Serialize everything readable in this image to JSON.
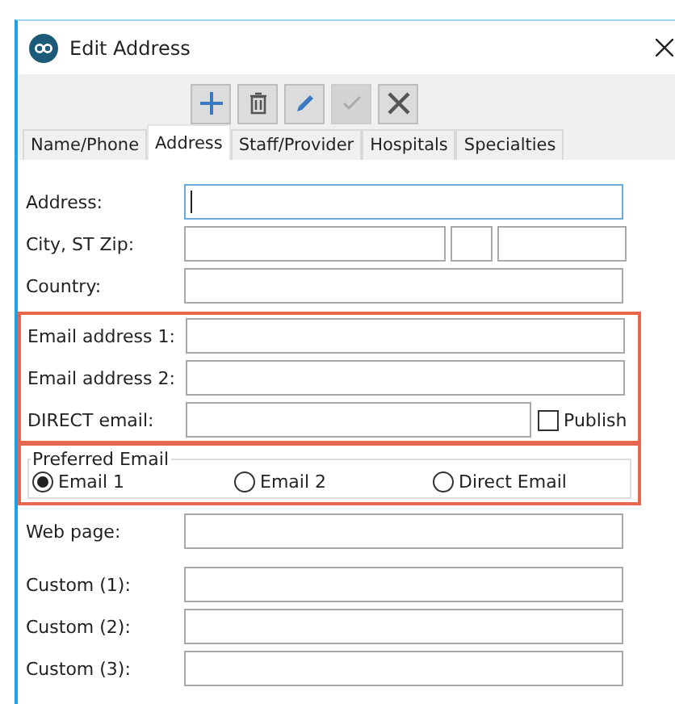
{
  "window": {
    "title": "Edit Address"
  },
  "toolbar": [
    {
      "kind": "add",
      "disabled": false
    },
    {
      "kind": "delete",
      "disabled": false
    },
    {
      "kind": "edit",
      "disabled": false
    },
    {
      "kind": "save",
      "disabled": true
    },
    {
      "kind": "cancel",
      "disabled": false
    }
  ],
  "tabs": [
    {
      "label": "Name/Phone",
      "selected": false
    },
    {
      "label": "Address",
      "selected": true
    },
    {
      "label": "Staff/Provider",
      "selected": false
    },
    {
      "label": "Hospitals",
      "selected": false
    },
    {
      "label": "Specialties",
      "selected": false
    }
  ],
  "sections": [
    {
      "highlighted": false,
      "rows": [
        {
          "kind": "text",
          "label": "Address:",
          "focused": true
        },
        {
          "kind": "city",
          "label": "City, ST Zip:",
          "focused": false
        },
        {
          "kind": "text",
          "label": "Country:",
          "focused": false
        }
      ]
    },
    {
      "highlighted": true,
      "rows": [
        {
          "kind": "text",
          "label": "Email address 1:",
          "focused": false
        },
        {
          "kind": "text",
          "label": "Email address 2:",
          "focused": false
        },
        {
          "kind": "checkbox",
          "label": "DIRECT email:",
          "focused": false,
          "checkbox": {
            "label": "Publish",
            "checked": false
          }
        }
      ]
    },
    {
      "highlighted": true,
      "group": {
        "legend": "Preferred Email",
        "options": [
          {
            "label": "Email 1",
            "selected": true
          },
          {
            "label": "Email 2",
            "selected": false
          },
          {
            "label": "Direct Email",
            "selected": false
          }
        ]
      }
    },
    {
      "highlighted": false,
      "rows": [
        {
          "kind": "text",
          "label": "Web page:",
          "focused": false
        }
      ]
    },
    {
      "highlighted": false,
      "rows": [
        {
          "kind": "text",
          "label": "Custom (1):",
          "focused": false
        },
        {
          "kind": "text",
          "label": "Custom (2):",
          "focused": false
        },
        {
          "kind": "text",
          "label": "Custom (3):",
          "focused": false
        }
      ]
    }
  ]
}
